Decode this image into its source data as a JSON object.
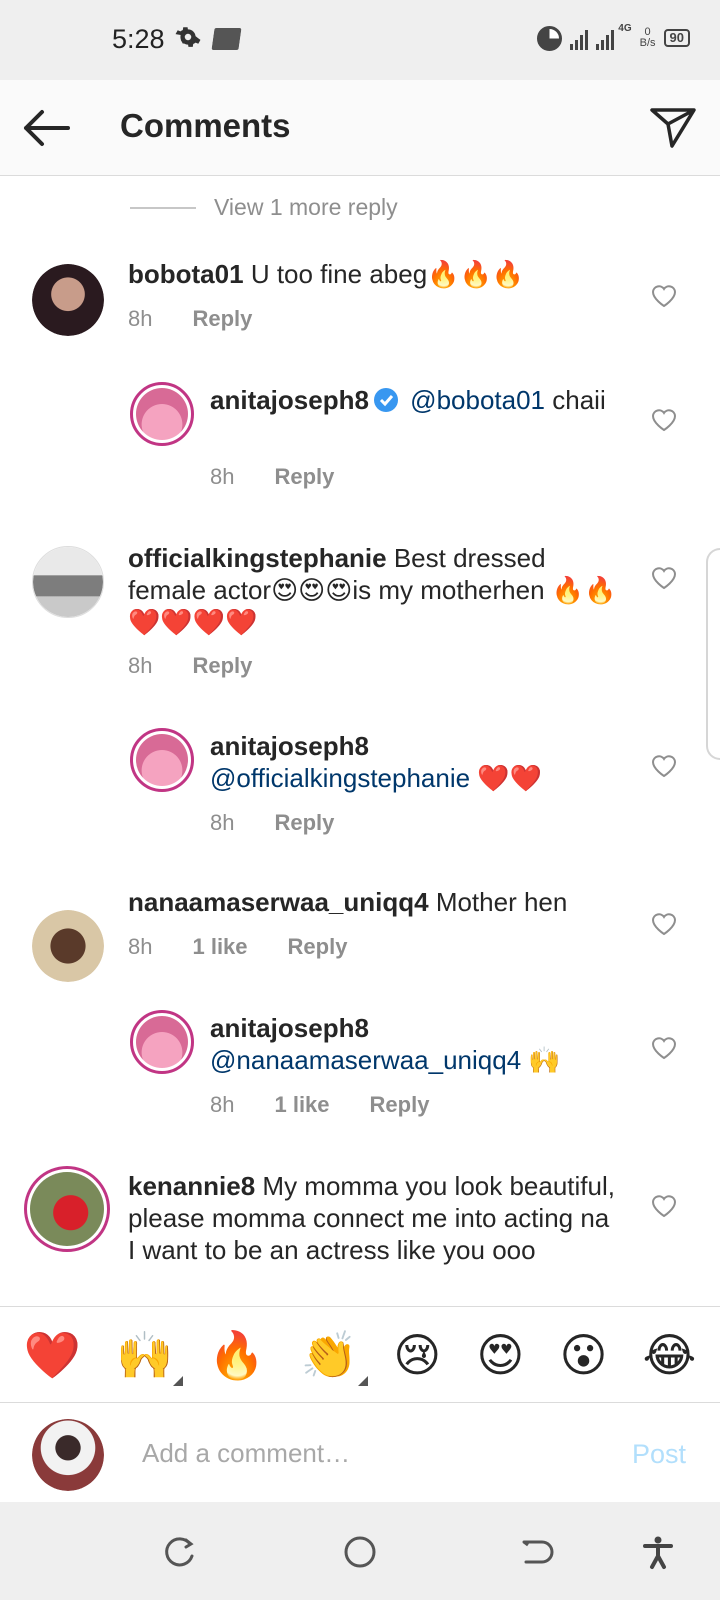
{
  "status_bar": {
    "time": "5:28",
    "network_type": "4G",
    "data_rate_value": "0",
    "data_rate_unit": "B/s",
    "battery": "90"
  },
  "header": {
    "title": "Comments"
  },
  "view_more_replies": "View 1 more reply",
  "comments": [
    {
      "username": "bobota01",
      "text": "U too fine abeg🔥🔥🔥",
      "time": "8h",
      "likes": "",
      "reply_label": "Reply"
    },
    {
      "username": "anitajoseph8",
      "mention": "@bobota01",
      "text": "chaii",
      "time": "8h",
      "likes": "",
      "reply_label": "Reply"
    },
    {
      "username": "officialkingstephanie",
      "text": "Best dressed female actor😍😍😍is my motherhen 🔥🔥❤️❤️❤️❤️",
      "time": "8h",
      "likes": "",
      "reply_label": "Reply"
    },
    {
      "username": "anitajoseph8",
      "mention": "@officialkingstephanie",
      "text": "❤️❤️",
      "time": "8h",
      "likes": "",
      "reply_label": "Reply"
    },
    {
      "username": "nanaamaserwaa_uniqq4",
      "text": "Mother hen",
      "time": "8h",
      "likes": "1 like",
      "reply_label": "Reply"
    },
    {
      "username": "anitajoseph8",
      "mention": "@nanaamaserwaa_uniqq4",
      "text": "🙌",
      "time": "8h",
      "likes": "1 like",
      "reply_label": "Reply"
    },
    {
      "username": "kenannie8",
      "text": "My momma you look beautiful, please momma connect me into acting na I want to be an actress like you ooo"
    }
  ],
  "emoji_bar": [
    "❤️",
    "🙌",
    "🔥",
    "👏",
    "😢",
    "😍",
    "😮",
    "😂"
  ],
  "composer": {
    "placeholder": "Add a comment…",
    "post_label": "Post"
  },
  "colors": {
    "link": "#00376b",
    "post_disabled": "#b2dffc",
    "story_ring": "#c13584",
    "verified": "#3897f0"
  },
  "icons": [
    "gear-icon",
    "sim-card-icon",
    "back-arrow-icon",
    "send-icon",
    "heart-icon",
    "verified-badge-icon",
    "recent-apps-icon",
    "home-icon",
    "back-icon",
    "accessibility-icon"
  ]
}
